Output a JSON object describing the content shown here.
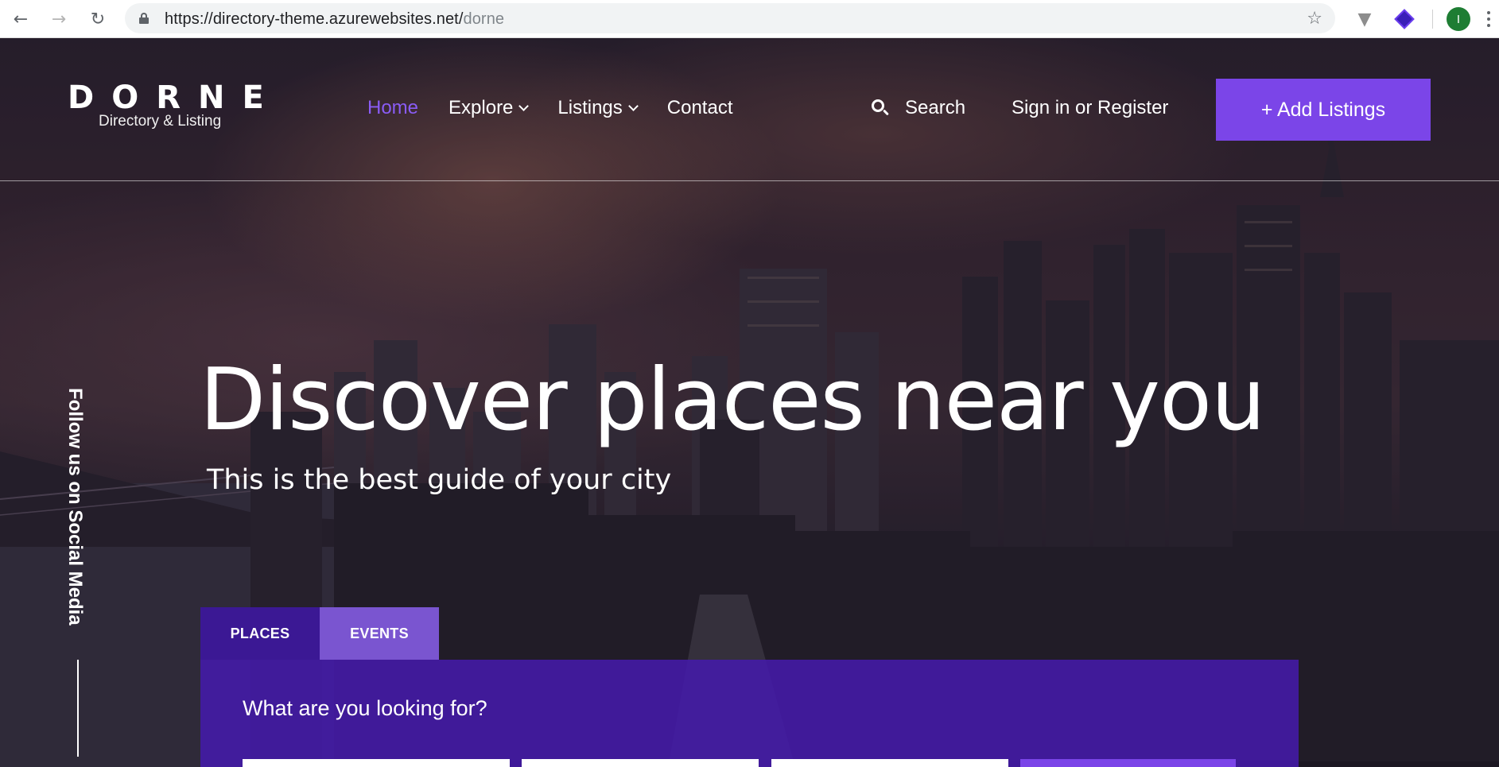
{
  "browser": {
    "url_host": "https://directory-theme.azurewebsites.net/",
    "url_path": "dorne",
    "profile_initial": "I"
  },
  "header": {
    "logo_word": "DORNE",
    "logo_sub": "Directory & Listing",
    "nav": [
      {
        "label": "Home",
        "active": true
      },
      {
        "label": "Explore",
        "dropdown": true
      },
      {
        "label": "Listings",
        "dropdown": true
      },
      {
        "label": "Contact"
      }
    ],
    "search_label": "Search",
    "signin_label": "Sign in or Register",
    "add_label": "+ Add Listings"
  },
  "hero": {
    "title": "Discover places near you",
    "subtitle": "This is the best guide of your city",
    "social_label": "Follow us on Social Media"
  },
  "search_panel": {
    "tabs": [
      "PLACES",
      "EVENTS"
    ],
    "title": "What are you looking for?"
  },
  "colors": {
    "accent": "#7b45e8",
    "active_nav": "#8a5cf5",
    "panel": "#441aaa"
  }
}
